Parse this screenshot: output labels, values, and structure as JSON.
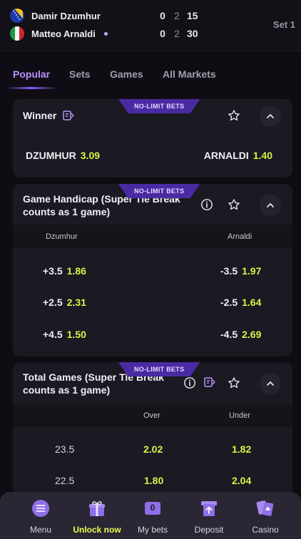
{
  "scoreboard": {
    "players": [
      {
        "name": "Damir Dzumhur",
        "sets": "0",
        "games": "2",
        "points": "15",
        "serving": false
      },
      {
        "name": "Matteo Arnaldi",
        "sets": "0",
        "games": "2",
        "points": "30",
        "serving": true
      }
    ],
    "set_label": "Set 1"
  },
  "tabs": [
    "Popular",
    "Sets",
    "Games",
    "All Markets"
  ],
  "badge": "NO-LIMIT BETS",
  "winner": {
    "title": "Winner",
    "home": {
      "label": "DZUMHUR",
      "odds": "3.09"
    },
    "away": {
      "label": "ARNALDI",
      "odds": "1.40"
    }
  },
  "handicap": {
    "title_line1": "Game Handicap (Super Tie Break",
    "title_line2": "counts as 1 game)",
    "col_home": "Dzumhur",
    "col_away": "Arnaldi",
    "rows": [
      {
        "home_line": "+3.5",
        "home_odds": "1.86",
        "away_line": "-3.5",
        "away_odds": "1.97"
      },
      {
        "home_line": "+2.5",
        "home_odds": "2.31",
        "away_line": "-2.5",
        "away_odds": "1.64"
      },
      {
        "home_line": "+4.5",
        "home_odds": "1.50",
        "away_line": "-4.5",
        "away_odds": "2.69"
      }
    ]
  },
  "totals": {
    "title_line1": "Total Games (Super Tie Break",
    "title_line2": "counts as 1 game)",
    "col_over": "Over",
    "col_under": "Under",
    "rows": [
      {
        "line": "23.5",
        "over": "2.02",
        "under": "1.82"
      },
      {
        "line": "22.5",
        "over": "1.80",
        "under": "2.04"
      }
    ]
  },
  "bottom_nav": [
    {
      "label": "Menu",
      "icon": "menu-icon"
    },
    {
      "label": "Unlock now",
      "icon": "gift-icon"
    },
    {
      "label": "My bets",
      "icon": "betslip-icon",
      "count": "0"
    },
    {
      "label": "Deposit",
      "icon": "deposit-icon"
    },
    {
      "label": "Casino",
      "icon": "cards-icon"
    }
  ],
  "colors": {
    "accent": "#8c5cff",
    "odds": "#d9f24a",
    "card": "#1b1921",
    "background": "#0f0d13"
  }
}
